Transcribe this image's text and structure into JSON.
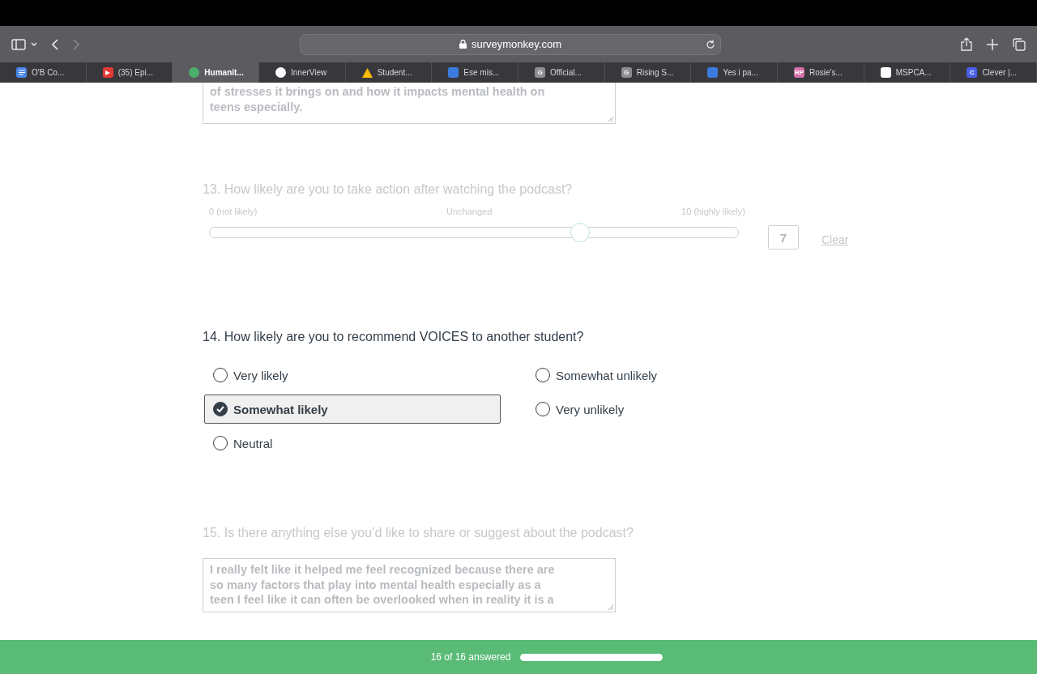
{
  "browser": {
    "address": "surveymonkey.com",
    "tabs": [
      {
        "label": "O'B Co...",
        "selected": false,
        "favicon": {
          "kind": "doc",
          "color": "#4a86e8"
        }
      },
      {
        "label": "(35) Epi...",
        "selected": false,
        "favicon": {
          "kind": "play",
          "color": "#e53935"
        }
      },
      {
        "label": "Humanit...",
        "selected": true,
        "favicon": {
          "kind": "circle",
          "color": "#4caf6a"
        }
      },
      {
        "label": "InnerView",
        "selected": false,
        "favicon": {
          "kind": "circle",
          "color": "#ffffff"
        }
      },
      {
        "label": "Student...",
        "selected": false,
        "favicon": {
          "kind": "triangle",
          "color": "#fbbc04"
        }
      },
      {
        "label": "Ese mis...",
        "selected": false,
        "favicon": {
          "kind": "square",
          "color": "#3b7be0"
        }
      },
      {
        "label": "Official...",
        "selected": false,
        "favicon": {
          "kind": "letter",
          "color": "#8e8e93",
          "glyph": "G"
        }
      },
      {
        "label": "Rising S...",
        "selected": false,
        "favicon": {
          "kind": "letter",
          "color": "#8e8e93",
          "glyph": "G"
        }
      },
      {
        "label": "Yes i pa...",
        "selected": false,
        "favicon": {
          "kind": "square",
          "color": "#3b7be0"
        }
      },
      {
        "label": "Rosie's...",
        "selected": false,
        "favicon": {
          "kind": "letter",
          "color": "#d36fa8",
          "glyph": "RP"
        }
      },
      {
        "label": "MSPCA...",
        "selected": false,
        "favicon": {
          "kind": "square",
          "color": "#ffffff"
        }
      },
      {
        "label": "Clever |...",
        "selected": false,
        "favicon": {
          "kind": "letter",
          "color": "#4a5ee8",
          "glyph": "C"
        }
      }
    ]
  },
  "survey": {
    "questions": [
      {
        "kind": "text",
        "active": false,
        "answer_lines": [
          "of stresses it brings on and how it impacts mental health on",
          "teens especially."
        ]
      },
      {
        "kind": "slider",
        "active": false,
        "title": "13. How likely are you to take action after watching the podcast?",
        "min_label": "0 (not likely)",
        "mid_label": "Unchanged",
        "max_label": "10 (highly likely)",
        "level": 0.7,
        "value": "7",
        "clear": "Clear"
      },
      {
        "kind": "choice",
        "active": true,
        "title": "14. How likely are you to recommend VOICES to another student?",
        "options": [
          {
            "label": "Very likely",
            "selected": false
          },
          {
            "label": "Somewhat likely",
            "selected": true
          },
          {
            "label": "Neutral",
            "selected": false
          },
          {
            "label": "Somewhat unlikely",
            "selected": false
          },
          {
            "label": "Very unlikely",
            "selected": false
          }
        ]
      },
      {
        "kind": "text",
        "active": false,
        "title": "15. Is there anything else you’d like to share or suggest about the podcast?",
        "answer_lines": [
          "I really felt like it helped me feel recognized because there are",
          "so many factors that play into mental health especially as a",
          "teen I feel like it can often be overlooked when in reality it is a"
        ]
      }
    ]
  },
  "footer": {
    "progress_text": "16 of 16 answered",
    "level": 1
  }
}
